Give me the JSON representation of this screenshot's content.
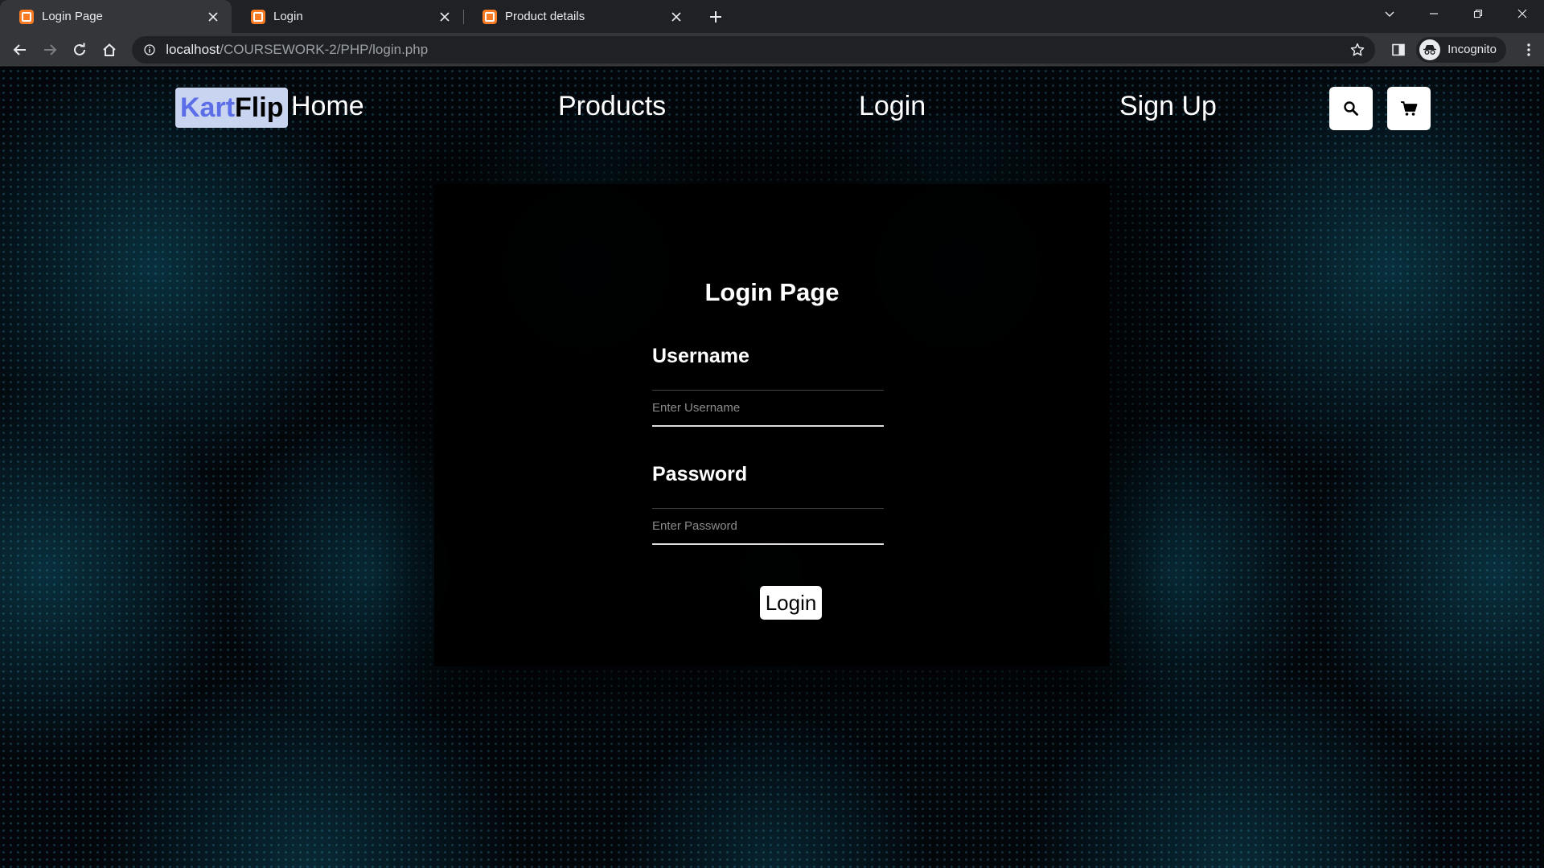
{
  "browser": {
    "tabs": [
      {
        "title": "Login Page",
        "active": true
      },
      {
        "title": "Login",
        "active": false
      },
      {
        "title": "Product details",
        "active": false
      }
    ],
    "url_host": "localhost",
    "url_path": "/COURSEWORK-2/PHP/login.php",
    "profile_label": "Incognito"
  },
  "navbar": {
    "logo_part1": "Kart",
    "logo_part2": "Flip",
    "links": {
      "home": "Home",
      "products": "Products",
      "login": "Login",
      "signup": "Sign Up"
    }
  },
  "login_form": {
    "title": "Login Page",
    "username_label": "Username",
    "username_placeholder": "Enter Username",
    "password_label": "Password",
    "password_placeholder": "Enter Password",
    "submit_label": "Login"
  },
  "colors": {
    "logo_accent": "#5b6ee8",
    "logo_background": "#c9d4f0",
    "page_background": "#03070c",
    "tab_favicon": "#fb7a24"
  },
  "icons": {
    "search_button": "search-icon",
    "cart_button": "cart-icon"
  }
}
